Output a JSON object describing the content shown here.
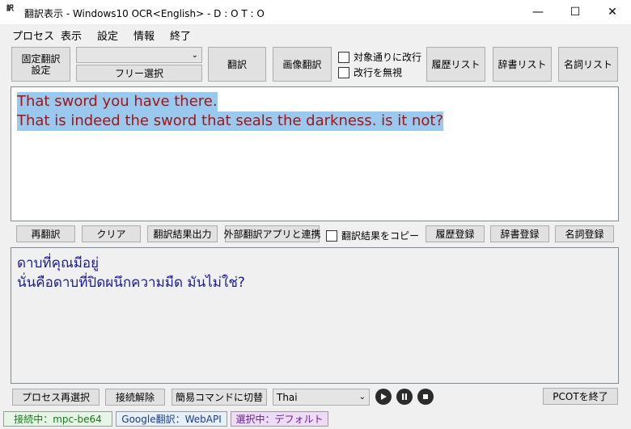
{
  "window": {
    "title": "翻訳表示 - Windows10 OCR<English> - D : O T : O",
    "icon_text": "訳",
    "controls": {
      "minimize": "—",
      "maximize": "☐",
      "close": "✕"
    }
  },
  "menu": {
    "items": [
      "プロセス",
      "表示",
      "設定",
      "情報",
      "終了"
    ]
  },
  "toolbar": {
    "fixed_translate_settings": "固定翻訳\n設定",
    "region_combo_value": "",
    "free_select": "フリー選択",
    "translate": "翻訳",
    "image_translate": "画像翻訳",
    "newline_as_source": "対象通りに改行",
    "ignore_newline": "改行を無視",
    "history_list": "履歴リスト",
    "dictionary_list": "辞書リスト",
    "noun_list": "名詞リスト"
  },
  "source_text": {
    "lines": [
      "That sword you have there. ",
      "That is indeed the sword that seals the darkness. is it not?"
    ]
  },
  "actions": {
    "retranslate": "再翻訳",
    "clear": "クリア",
    "export_result": "翻訳結果出力",
    "external_app": "外部翻訳アプリと連携",
    "copy_result": "翻訳結果をコピー",
    "history_register": "履歴登録",
    "dictionary_register": "辞書登録",
    "noun_register": "名詞登録"
  },
  "target_text": {
    "lines": [
      "ดาบที่คุณมีอยู่",
      "นั่นคือดาบที่ปิดผนึกความมืด มันไม่ใช่?"
    ]
  },
  "bottom": {
    "reselect_process": "プロセス再選択",
    "disconnect": "接続解除",
    "switch_simple_command": "簡易コマンドに切替",
    "language_select": "Thai",
    "quit": "PCOTを終了"
  },
  "status": {
    "connected": "接続中：mpc-be64",
    "engine": "Google翻訳：WebAPI",
    "selection": "選択中：デフォルト"
  },
  "colors": {
    "source_text": "#a31515",
    "source_highlight": "#99c9ef",
    "target_text": "#1a1a9c",
    "status_connected_bg": "#e6f6e6",
    "status_engine_bg": "#e6f0fa",
    "status_selection_bg": "#ecdcf6"
  }
}
